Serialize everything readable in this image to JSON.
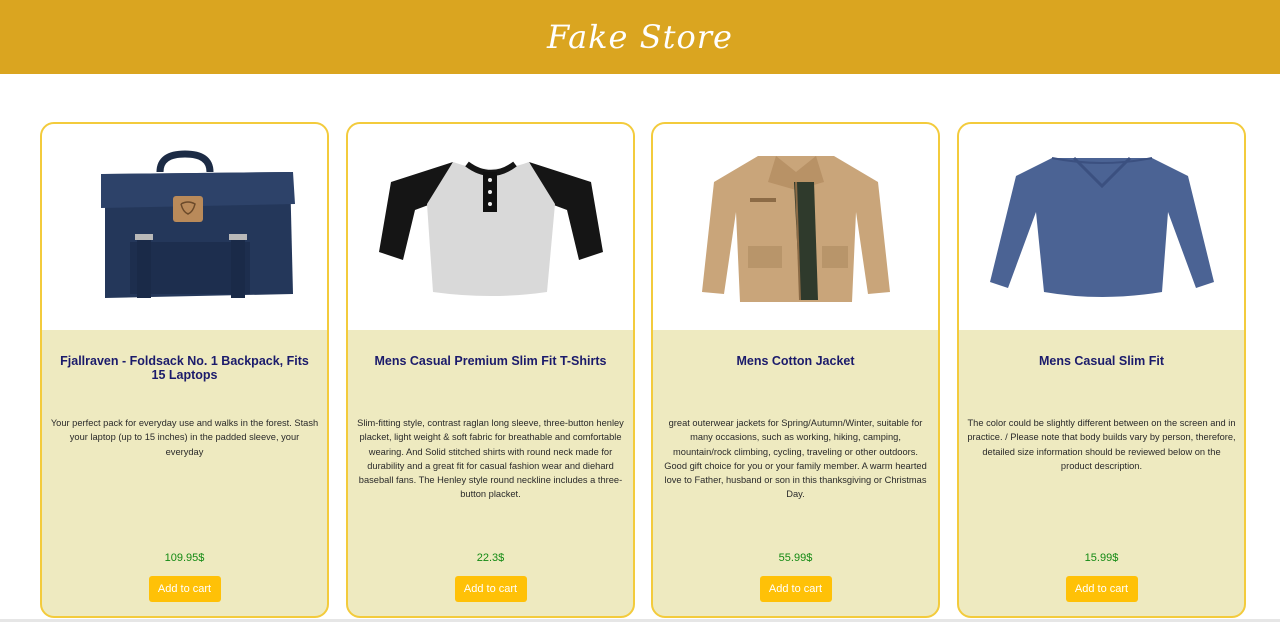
{
  "header": {
    "title": "Fake Store"
  },
  "colors": {
    "header_bg": "#daa520",
    "card_border": "#f3cb3c",
    "card_bg": "#eeeac0",
    "button_bg": "#ffc107",
    "price": "#138a13",
    "title": "#1b1b6b"
  },
  "products": [
    {
      "title": "Fjallraven - Foldsack No. 1 Backpack, Fits 15 Laptops",
      "description": "Your perfect pack for everyday use and walks in the forest. Stash your laptop (up to 15 inches) in the padded sleeve, your everyday",
      "price": "109.95$",
      "button_label": "Add to cart",
      "image_icon": "backpack-image"
    },
    {
      "title": "Mens Casual Premium Slim Fit T-Shirts",
      "description": "Slim-fitting style, contrast raglan long sleeve, three-button henley placket, light weight & soft fabric for breathable and comfortable wearing. And Solid stitched shirts with round neck made for durability and a great fit for casual fashion wear and diehard baseball fans. The Henley style round neckline includes a three-button placket.",
      "price": "22.3$",
      "button_label": "Add to cart",
      "image_icon": "tshirt-image"
    },
    {
      "title": "Mens Cotton Jacket",
      "description": "great outerwear jackets for Spring/Autumn/Winter, suitable for many occasions, such as working, hiking, camping, mountain/rock climbing, cycling, traveling or other outdoors. Good gift choice for you or your family member. A warm hearted love to Father, husband or son in this thanksgiving or Christmas Day.",
      "price": "55.99$",
      "button_label": "Add to cart",
      "image_icon": "jacket-image"
    },
    {
      "title": "Mens Casual Slim Fit",
      "description": "The color could be slightly different between on the screen and in practice. / Please note that body builds vary by person, therefore, detailed size information should be reviewed below on the product description.",
      "price": "15.99$",
      "button_label": "Add to cart",
      "image_icon": "longsleeve-image"
    }
  ]
}
